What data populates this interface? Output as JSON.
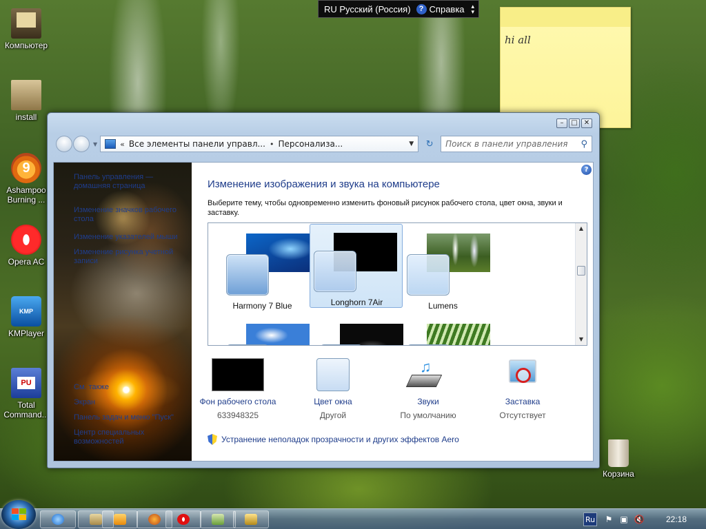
{
  "langbar": {
    "label": "RU Русский (Россия)",
    "help_label": "Справка"
  },
  "sticky_note": {
    "text": "hi all"
  },
  "desktop_icons": [
    {
      "label": "Компьютер",
      "icon": "computer-icon"
    },
    {
      "label": "install",
      "icon": "install-icon"
    },
    {
      "label": "Ashampoo Burning ...",
      "icon": "ashampoo-icon"
    },
    {
      "label": "Opera AC",
      "icon": "opera-icon"
    },
    {
      "label": "KMPlayer",
      "icon": "kmplayer-icon"
    },
    {
      "label": "Total Command...",
      "icon": "total-commander-icon"
    },
    {
      "label": "Корзина",
      "icon": "recycle-bin-icon"
    }
  ],
  "kmp_text": "KMP",
  "window": {
    "breadcrumb": [
      "Все элементы панели управл...",
      "Персонализа..."
    ],
    "search_placeholder": "Поиск в панели управления",
    "left_links": [
      "Панель управления — домашняя страница",
      "Изменение значков рабочего стола",
      "Изменение указателей мыши",
      "Изменение рисунка учетной записи",
      "См. также",
      "Экран",
      "Панель задач и меню \"Пуск\"",
      "Центр специальных возможностей"
    ],
    "title": "Изменение изображения и звука на компьютере",
    "description": "Выберите тему, чтобы одновременно изменить фоновый рисунок рабочего стола, цвет окна, звуки и заставку.",
    "themes": [
      {
        "name": "Harmony 7 Blue",
        "selected": false
      },
      {
        "name": "Longhorn 7Air",
        "selected": true
      },
      {
        "name": "Lumens",
        "selected": false
      }
    ],
    "options": [
      {
        "link": "Фон рабочего стола",
        "sub": "633948325"
      },
      {
        "link": "Цвет окна",
        "sub": "Другой"
      },
      {
        "link": "Звуки",
        "sub": "По умолчанию"
      },
      {
        "link": "Заставка",
        "sub": "Отсутствует"
      }
    ],
    "aero_link": "Устранение неполадок прозрачности и других эффектов Aero"
  },
  "taskbar": {
    "lang": "Ru",
    "clock": "22:18"
  },
  "colors": {
    "link": "#1e3c8a",
    "title": "#1e3c8a",
    "selection_border": "#84acdd"
  }
}
